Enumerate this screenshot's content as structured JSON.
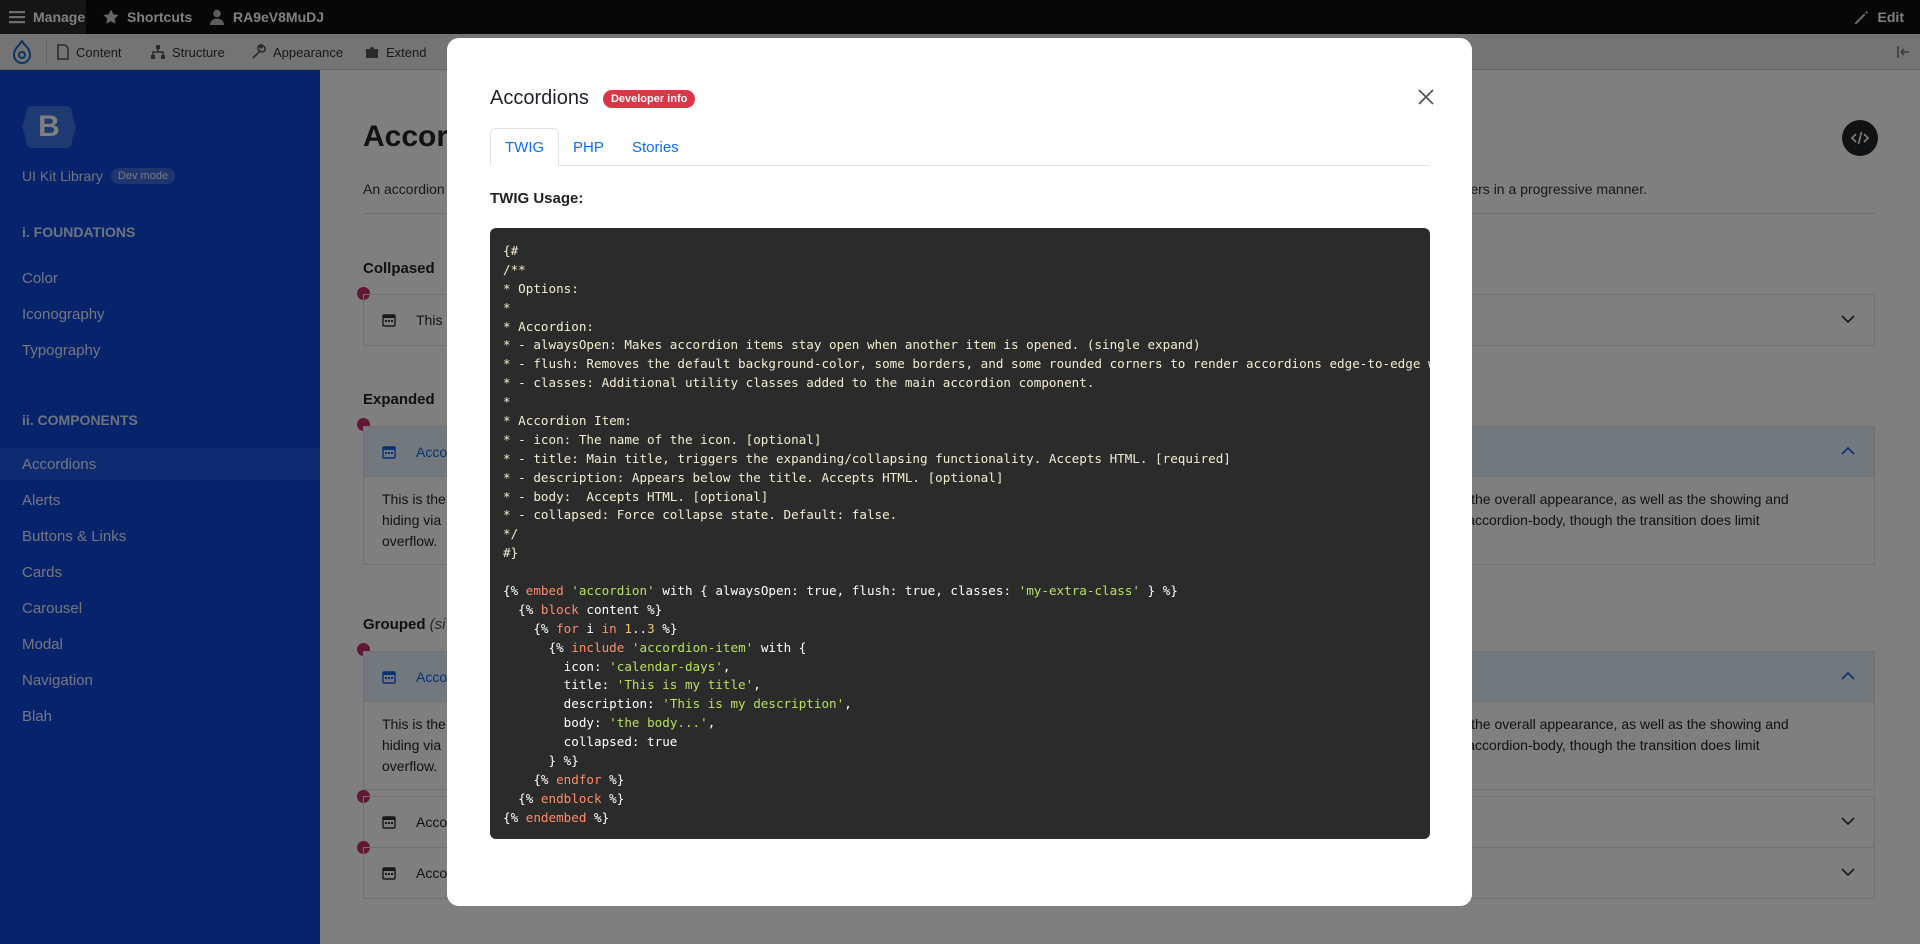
{
  "topbar": {
    "manage": "Manage",
    "shortcuts": "Shortcuts",
    "user": "RA9eV8MuDJ",
    "edit": "Edit"
  },
  "toolbar": {
    "items": [
      "Content",
      "Structure",
      "Appearance",
      "Extend"
    ]
  },
  "sidebar": {
    "logo_letter": "B",
    "brand": "UI Kit Library",
    "badge": "Dev mode",
    "foundations_head": "i. FOUNDATIONS",
    "foundations": [
      "Color",
      "Iconography",
      "Typography"
    ],
    "components_head": "ii. COMPONENTS",
    "components": [
      "Accordions",
      "Alerts",
      "Buttons & Links",
      "Cards",
      "Carousel",
      "Modal",
      "Navigation",
      "Blah"
    ],
    "active": "Accordions"
  },
  "page": {
    "title": "Accor",
    "desc_left": "An accordion",
    "desc_right": "to users in a progressive manner.",
    "collapsed_label": "Collpased",
    "collapsed_item": "This",
    "expanded_label": "Expanded",
    "expanded_item": "Accor",
    "body_left_1": "This is the",
    "body_left_2": "hiding via",
    "body_left_3": "overflow.",
    "body_right_1": "ntrol the overall appearance, as well as the showing and",
    "body_right_2": "the .accordion-body, though the transition does limit",
    "grouped_label": "Grouped",
    "grouped_note": "(si",
    "grouped_item": "Accor",
    "grouped_item_2": "Accor",
    "grouped_item_3": "Accor"
  },
  "modal": {
    "title": "Accordions",
    "badge": "Developer info",
    "tabs": [
      "TWIG",
      "PHP",
      "Stories"
    ],
    "active_tab": "TWIG",
    "usage_label": "TWIG Usage:"
  },
  "code": {
    "comment_lines": [
      "{#",
      "/**",
      "* Options:",
      "*",
      "* Accordion:",
      "* - alwaysOpen: Makes accordion items stay open when another item is opened. (single expand)",
      "* - flush: Removes the default background-color, some borders, and some rounded corners to render accordions edge-to-edge w",
      "* - classes: Additional utility classes added to the main accordion component.",
      "*",
      "* Accordion Item:",
      "* - icon: The name of the icon. [optional]",
      "* - title: Main title, triggers the expanding/collapsing functionality. Accepts HTML. [required]",
      "* - description: Appears below the title. Accepts HTML. [optional]",
      "* - body:  Accepts HTML. [optional]",
      "* - collapsed: Force collapse state. Default: false.",
      "*/",
      "#}"
    ],
    "embed_line": {
      "open": "{% ",
      "kw": "embed",
      "s1": " ",
      "str": "'accordion'",
      "rest": " with { alwaysOpen: true, flush: true, classes: ",
      "str2": "'my-extra-class'",
      "close": " } %}"
    },
    "block_line": {
      "open": "  {% ",
      "kw": "block",
      "rest": " content %}"
    },
    "for_line": {
      "open": "    {% ",
      "kw": "for",
      "mid": " i ",
      "kw2": "in",
      "s": " ",
      "n1": "1",
      "dots": "..",
      "n2": "3",
      "close": " %}"
    },
    "include_line": {
      "open": "      {% ",
      "kw": "include",
      "s": " ",
      "str": "'accordion-item'",
      "rest": " with {"
    },
    "icon_line": {
      "key": "        icon: ",
      "str": "'calendar-days'",
      "end": ","
    },
    "title_line": {
      "key": "        title: ",
      "str": "'This is my title'",
      "end": ","
    },
    "desc_line": {
      "key": "        description: ",
      "str": "'This is my description'",
      "end": ","
    },
    "body_line": {
      "key": "        body: ",
      "str": "'the body...'",
      "end": ","
    },
    "collapsed_line": "        collapsed: true",
    "close_include": "      } %}",
    "endfor_line": {
      "open": "    {% ",
      "kw": "endfor",
      "close": " %}"
    },
    "endblock_line": {
      "open": "  {% ",
      "kw": "endblock",
      "close": " %}"
    },
    "endembed_line": {
      "open": "{% ",
      "kw": "endembed",
      "close": " %}"
    }
  },
  "colors": {
    "sidebar": "#0d47d9",
    "accent_red": "#dc3545",
    "code_bg": "#2b2b2b",
    "link": "#0d6efd"
  }
}
